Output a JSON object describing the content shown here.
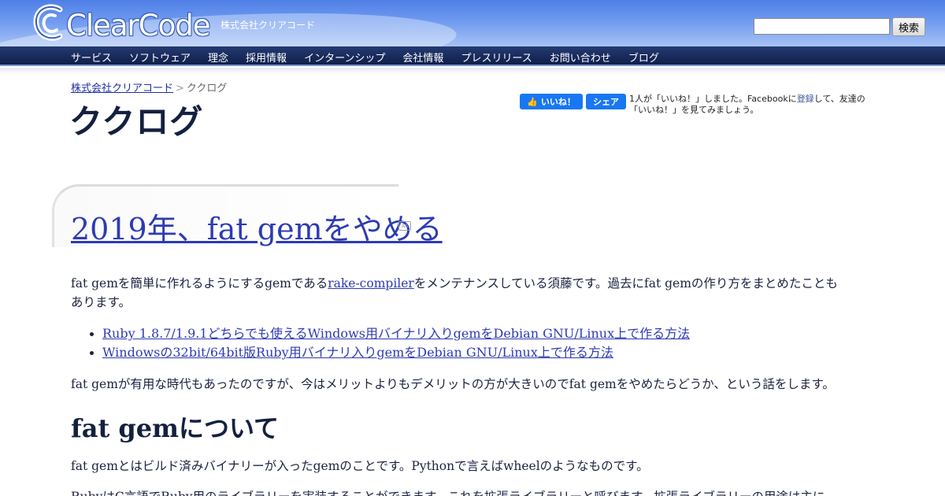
{
  "header": {
    "logo_text": "ClearCode",
    "company_tag": "株式会社クリアコード",
    "search_placeholder": "",
    "search_button": "検索"
  },
  "nav": {
    "items": [
      {
        "label": "サービス"
      },
      {
        "label": "ソフトウェア"
      },
      {
        "label": "理念"
      },
      {
        "label": "採用情報"
      },
      {
        "label": "インターンシップ"
      },
      {
        "label": "会社情報"
      },
      {
        "label": "プレスリリース"
      },
      {
        "label": "お問い合わせ"
      },
      {
        "label": "ブログ"
      }
    ]
  },
  "breadcrumb": {
    "home": "株式会社クリアコード",
    "separator": ">",
    "current": "ククログ"
  },
  "page_title": "ククログ",
  "facebook": {
    "like_label": "いいね！",
    "share_label": "シェア",
    "text_before": "1人が「いいね！」しました。Facebookに",
    "register_link": "登録",
    "text_after": "して、友達の「いいね！」を見てみましょう。"
  },
  "article": {
    "title": "2019年、fat gemをやめる",
    "feed_icon_label": "AA",
    "p1_before": "fat gemを簡単に作れるようにするgemである",
    "p1_link": "rake-compiler",
    "p1_after": "をメンテナンスしている須藤です。過去にfat gemの作り方をまとめたこともあります。",
    "links": [
      "Ruby 1.8.7/1.9.1どちらでも使えるWindows用バイナリ入りgemをDebian GNU/Linux上で作る方法",
      "Windowsの32bit/64bit版Ruby用バイナリ入りgemをDebian GNU/Linux上で作る方法"
    ],
    "p2": "fat gemが有用な時代もあったのですが、今はメリットよりもデメリットの方が大きいのでfat gemをやめたらどうか、という話をします。",
    "h2": "fat gemについて",
    "p3": "fat gemとはビルド済みバイナリーが入ったgemのことです。Pythonで言えばwheelのようなものです。",
    "p4": "RubyはC言語でRuby用のライブラリーを実装することができます。これを拡張ライブラリーと呼びます。拡張ライブラリーの用途は主に"
  }
}
